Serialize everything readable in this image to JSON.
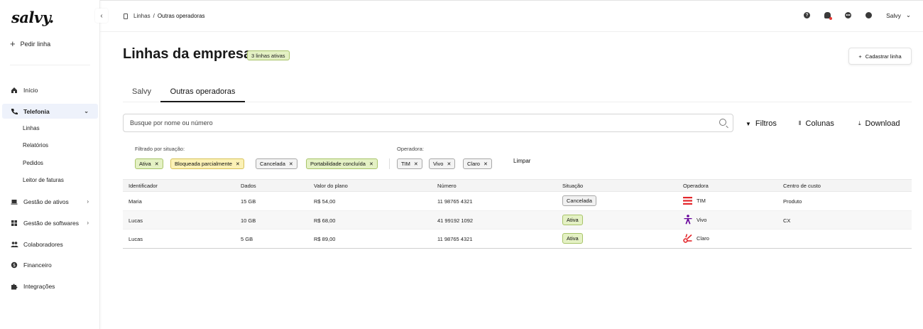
{
  "sidebar": {
    "logo": "salvy.",
    "order_line": "Pedir linha",
    "items": [
      {
        "label": "Início",
        "icon": "home-icon"
      },
      {
        "label": "Telefonia",
        "icon": "phone-icon"
      },
      {
        "label": "Gestão de ativos",
        "icon": "laptop-icon"
      },
      {
        "label": "Gestão de softwares",
        "icon": "apps-icon"
      },
      {
        "label": "Colaboradores",
        "icon": "people-icon"
      },
      {
        "label": "Financeiro",
        "icon": "money-icon"
      },
      {
        "label": "Integrações",
        "icon": "puzzle-icon"
      }
    ],
    "subitems": [
      "Linhas",
      "Relatórios",
      "Pedidos",
      "Leitor de faturas"
    ]
  },
  "breadcrumb": {
    "root": "Linhas",
    "separator": "/",
    "current": "Outras operadoras"
  },
  "header": {
    "user": "Salvy"
  },
  "page": {
    "title": "Linhas da empresa",
    "badge": "3 linhas ativas",
    "register_button": "Cadastrar linha"
  },
  "tabs": [
    {
      "label": "Salvy"
    },
    {
      "label": "Outras operadoras"
    }
  ],
  "search": {
    "placeholder": "Busque por nome ou número"
  },
  "toolbar": {
    "filters": "Filtros",
    "columns": "Colunas",
    "download": "Download"
  },
  "filters": {
    "status_label": "Filtrado por situação:",
    "status_chips": [
      "Ativa",
      "Bloqueada parcialmente",
      "Cancelada",
      "Portabilidade concluída"
    ],
    "operator_label": "Operadora:",
    "operator_chips": [
      "TIM",
      "Vivo",
      "Claro"
    ],
    "clear": "Limpar"
  },
  "table": {
    "headers": [
      "Identificador",
      "Dados",
      "Valor do plano",
      "Número",
      "Situação",
      "Operadora",
      "Centro de custo"
    ],
    "rows": [
      {
        "id": "Maria",
        "data": "15 GB",
        "price": "R$ 54,00",
        "number": "11 98765 4321",
        "status": "Cancelada",
        "operator": "TIM",
        "cost_center": "Produto"
      },
      {
        "id": "Lucas",
        "data": "10 GB",
        "price": "R$ 68,00",
        "number": "41 99192 1092",
        "status": "Ativa",
        "operator": "Vivo",
        "cost_center": "CX"
      },
      {
        "id": "Lucas",
        "data": "5 GB",
        "price": "R$ 89,00",
        "number": "11 98765 4321",
        "status": "Ativa",
        "operator": "Claro",
        "cost_center": ""
      }
    ]
  },
  "colors": {
    "active_green": "#e4f1c4",
    "warn_yellow": "#fbf1b6",
    "tim_red": "#e3262b",
    "vivo_purple": "#660099",
    "claro_red": "#e3262b",
    "active_nav": "#eef2fb"
  }
}
